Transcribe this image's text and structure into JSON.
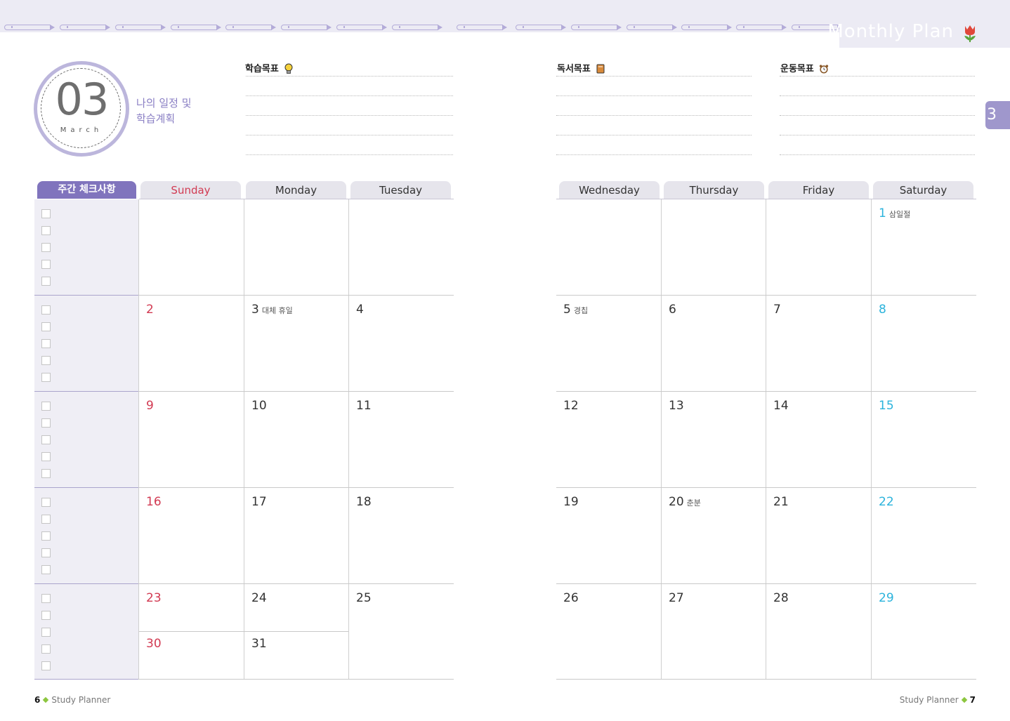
{
  "header": {
    "title": "Monthly Plan",
    "side_tab": "3"
  },
  "month": {
    "number": "03",
    "name": "March",
    "subtitle_line1": "나의 일정 및",
    "subtitle_line2": "학습계획"
  },
  "goals": {
    "study": "학습목표",
    "reading": "독서목표",
    "exercise": "운동목표"
  },
  "calendar": {
    "check_header": "주간 체크사항",
    "days": [
      "Sunday",
      "Monday",
      "Tuesday",
      "Wednesday",
      "Thursday",
      "Friday",
      "Saturday"
    ],
    "weeks": [
      [
        null,
        null,
        null,
        null,
        null,
        null,
        {
          "d": "1",
          "note": "삼일절"
        }
      ],
      [
        {
          "d": "2"
        },
        {
          "d": "3",
          "note": "대체 휴일"
        },
        {
          "d": "4"
        },
        {
          "d": "5",
          "note": "경칩"
        },
        {
          "d": "6"
        },
        {
          "d": "7"
        },
        {
          "d": "8"
        }
      ],
      [
        {
          "d": "9"
        },
        {
          "d": "10"
        },
        {
          "d": "11"
        },
        {
          "d": "12"
        },
        {
          "d": "13"
        },
        {
          "d": "14"
        },
        {
          "d": "15"
        }
      ],
      [
        {
          "d": "16"
        },
        {
          "d": "17"
        },
        {
          "d": "18"
        },
        {
          "d": "19"
        },
        {
          "d": "20",
          "note": "춘분"
        },
        {
          "d": "21"
        },
        {
          "d": "22"
        }
      ],
      [
        {
          "d": "23"
        },
        {
          "d": "24"
        },
        {
          "d": "25"
        },
        {
          "d": "26"
        },
        {
          "d": "27"
        },
        {
          "d": "28"
        },
        {
          "d": "29"
        }
      ]
    ],
    "extra": [
      {
        "d": "30"
      },
      {
        "d": "31"
      }
    ]
  },
  "footer": {
    "left_page": "6",
    "left_label": "Study Planner",
    "right_page": "7",
    "right_label": "Study Planner"
  },
  "colors": {
    "accent": "#8074bd",
    "sunday": "#d23a52",
    "saturday": "#2bb3dc"
  }
}
